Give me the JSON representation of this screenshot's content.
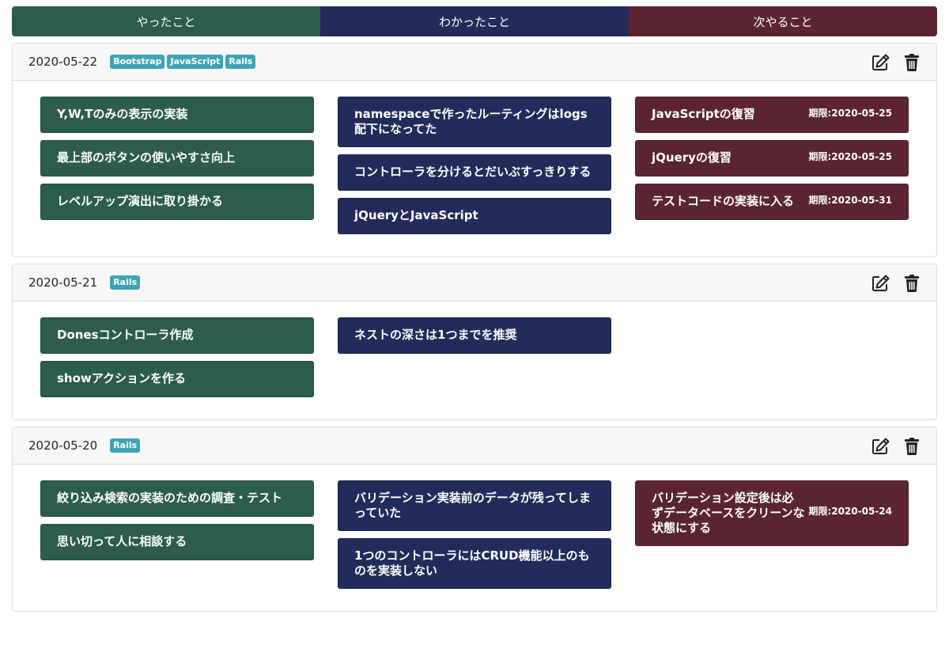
{
  "header": {
    "done_label": "やったこと",
    "learn_label": "わかったこと",
    "next_label": "次やること"
  },
  "colors": {
    "done": "#2b5c4d",
    "learn": "#232b5a",
    "next": "#5a2531",
    "tag": "#3ea4b4"
  },
  "icons": {
    "edit": "edit-icon",
    "delete": "trash-icon"
  },
  "entries": [
    {
      "date": "2020-05-22",
      "tags": [
        "Bootstrap",
        "JavaScript",
        "Rails"
      ],
      "done": [
        "Y,W,Tのみの表示の実装",
        "最上部のボタンの使いやすさ向上",
        "レベルアップ演出に取り掛かる"
      ],
      "learn": [
        "namespaceで作ったルーティングはlogs配下になってた",
        "コントローラを分けるとだいぶすっきりする",
        "jQueryとJavaScript"
      ],
      "next": [
        {
          "text": "JavaScriptの復習",
          "deadline": "期限:2020-05-25"
        },
        {
          "text": "jQueryの復習",
          "deadline": "期限:2020-05-25"
        },
        {
          "text": "テストコードの実装に入る",
          "deadline": "期限:2020-05-31"
        }
      ]
    },
    {
      "date": "2020-05-21",
      "tags": [
        "Rails"
      ],
      "done": [
        "Donesコントローラ作成",
        "showアクションを作る"
      ],
      "learn": [
        "ネストの深さは1つまでを推奨"
      ],
      "next": []
    },
    {
      "date": "2020-05-20",
      "tags": [
        "Rails"
      ],
      "done": [
        "絞り込み検索の実装のための調査・テスト",
        "思い切って人に相談する"
      ],
      "learn": [
        "バリデーション実装前のデータが残ってしまっていた",
        "1つのコントローラにはCRUD機能以上のものを実装しない"
      ],
      "next": [
        {
          "text": "バリデーション設定後は必ずデータベースをクリーンな状態にする",
          "deadline": "期限:2020-05-24"
        }
      ]
    }
  ]
}
